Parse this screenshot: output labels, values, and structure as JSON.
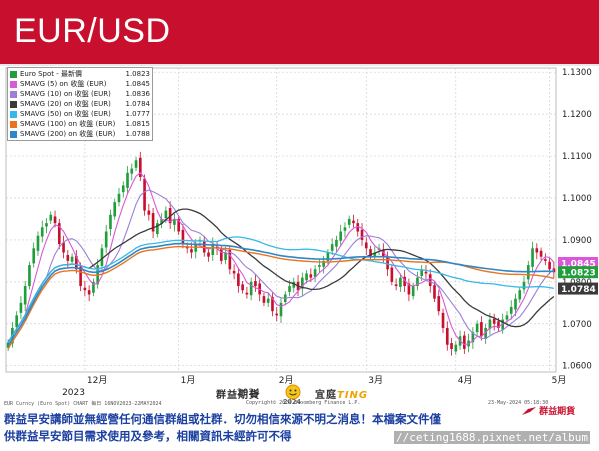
{
  "header": {
    "title": "EUR/USD",
    "background": "#c8102e"
  },
  "legend": [
    {
      "name": "Euro Spot - 最新價",
      "value": "1.0823",
      "color": "#1f9e3a"
    },
    {
      "name": "SMAVG (5)  on 收盤 (EUR)",
      "value": "1.0845",
      "color": "#d957d9"
    },
    {
      "name": "SMAVG (10)  on 收盤 (EUR)",
      "value": "1.0836",
      "color": "#9b7fd9"
    },
    {
      "name": "SMAVG (20)  on 收盤 (EUR)",
      "value": "1.0784",
      "color": "#3a3a3a"
    },
    {
      "name": "SMAVG (50)  on 收盤 (EUR)",
      "value": "1.0777",
      "color": "#35b9e6"
    },
    {
      "name": "SMAVG (100)  on 收盤 (EUR)",
      "value": "1.0815",
      "color": "#e8741e"
    },
    {
      "name": "SMAVG (200)  on 收盤 (EUR)",
      "value": "1.0788",
      "color": "#2f86c8"
    }
  ],
  "chart_data": {
    "type": "candlestick",
    "ylim": [
      1.0585,
      1.131
    ],
    "y_ticks": [
      "1.1300",
      "1.1200",
      "1.1100",
      "1.1000",
      "1.0900",
      "1.0800",
      "1.0700",
      "1.0600"
    ],
    "x_month_labels": [
      {
        "label": "12月",
        "index": 18
      },
      {
        "label": "1月",
        "index": 40
      },
      {
        "label": "2月",
        "index": 63
      },
      {
        "label": "3月",
        "index": 84
      },
      {
        "label": "4月",
        "index": 105
      },
      {
        "label": "5月",
        "index": 127
      }
    ],
    "x_year_labels": [
      {
        "label": "2023",
        "index": 15
      },
      {
        "label": "2024",
        "index": 56
      }
    ],
    "closes": [
      1.0655,
      1.069,
      1.072,
      1.075,
      1.079,
      1.084,
      1.088,
      1.091,
      1.093,
      1.094,
      1.096,
      1.094,
      1.089,
      1.087,
      1.085,
      1.086,
      1.083,
      1.079,
      1.078,
      1.077,
      1.08,
      1.084,
      1.088,
      1.092,
      1.096,
      1.099,
      1.101,
      1.103,
      1.106,
      1.107,
      1.109,
      1.105,
      1.097,
      1.096,
      1.092,
      1.094,
      1.095,
      1.097,
      1.094,
      1.095,
      1.092,
      1.089,
      1.088,
      1.087,
      1.089,
      1.09,
      1.087,
      1.086,
      1.089,
      1.088,
      1.085,
      1.087,
      1.083,
      1.082,
      1.079,
      1.078,
      1.077,
      1.08,
      1.079,
      1.077,
      1.075,
      1.076,
      1.073,
      1.072,
      1.075,
      1.077,
      1.079,
      1.08,
      1.078,
      1.081,
      1.082,
      1.081,
      1.083,
      1.084,
      1.085,
      1.087,
      1.089,
      1.09,
      1.092,
      1.093,
      1.095,
      1.094,
      1.092,
      1.09,
      1.088,
      1.086,
      1.087,
      1.088,
      1.086,
      1.083,
      1.08,
      1.079,
      1.081,
      1.079,
      1.077,
      1.079,
      1.081,
      1.083,
      1.082,
      1.079,
      1.076,
      1.073,
      1.069,
      1.065,
      1.064,
      1.065,
      1.067,
      1.064,
      1.066,
      1.068,
      1.07,
      1.067,
      1.069,
      1.071,
      1.07,
      1.069,
      1.071,
      1.072,
      1.074,
      1.076,
      1.078,
      1.08,
      1.084,
      1.088,
      1.087,
      1.086,
      1.085,
      1.083,
      1.0823
    ],
    "series": [
      {
        "name": "Euro Spot - 最新價",
        "value": 1.0823
      },
      {
        "name": "SMAVG (5)",
        "value": 1.0845
      },
      {
        "name": "SMAVG (10)",
        "value": 1.0836
      },
      {
        "name": "SMAVG (20)",
        "value": 1.0784
      },
      {
        "name": "SMAVG (50)",
        "value": 1.0777
      },
      {
        "name": "SMAVG (100)",
        "value": 1.0815
      },
      {
        "name": "SMAVG (200)",
        "value": 1.0788
      }
    ],
    "price_tags": [
      {
        "value": 1.0845,
        "label": "1.0845",
        "bg": "#d957d9"
      },
      {
        "value": 1.0823,
        "label": "1.0823",
        "bg": "#1f9e3a"
      },
      {
        "value": 1.0784,
        "label": "1.0784",
        "bg": "#3a3a3a"
      }
    ],
    "colors": {
      "up": "#1f9e3a",
      "down": "#c8102e",
      "grid": "#d0d0d0"
    }
  },
  "footer": {
    "source_note": "EUR Curncy (Euro Spot) CHART  每日 16NOV2023-22MAY2024",
    "copyright": "Copyright© 2024 Bloomberg Finance L.P.",
    "timestamp": "23-May-2024 05:18:30",
    "disclaimer_line1": "群益早安講師並無經營任何通信群組或社群．切勿相信來源不明之消息！本檔案文件僅",
    "disclaimer_line2": "供群益早安節目需求使用及參考，相關資訊未經許可不得",
    "watermark_left": "群益期貨",
    "watermark_right": "宜庭",
    "watermark_brand": "TING",
    "watermark_year": "2024",
    "url": "//ceting1688.pixnet.net/album",
    "logo_text": "群益期貨"
  }
}
